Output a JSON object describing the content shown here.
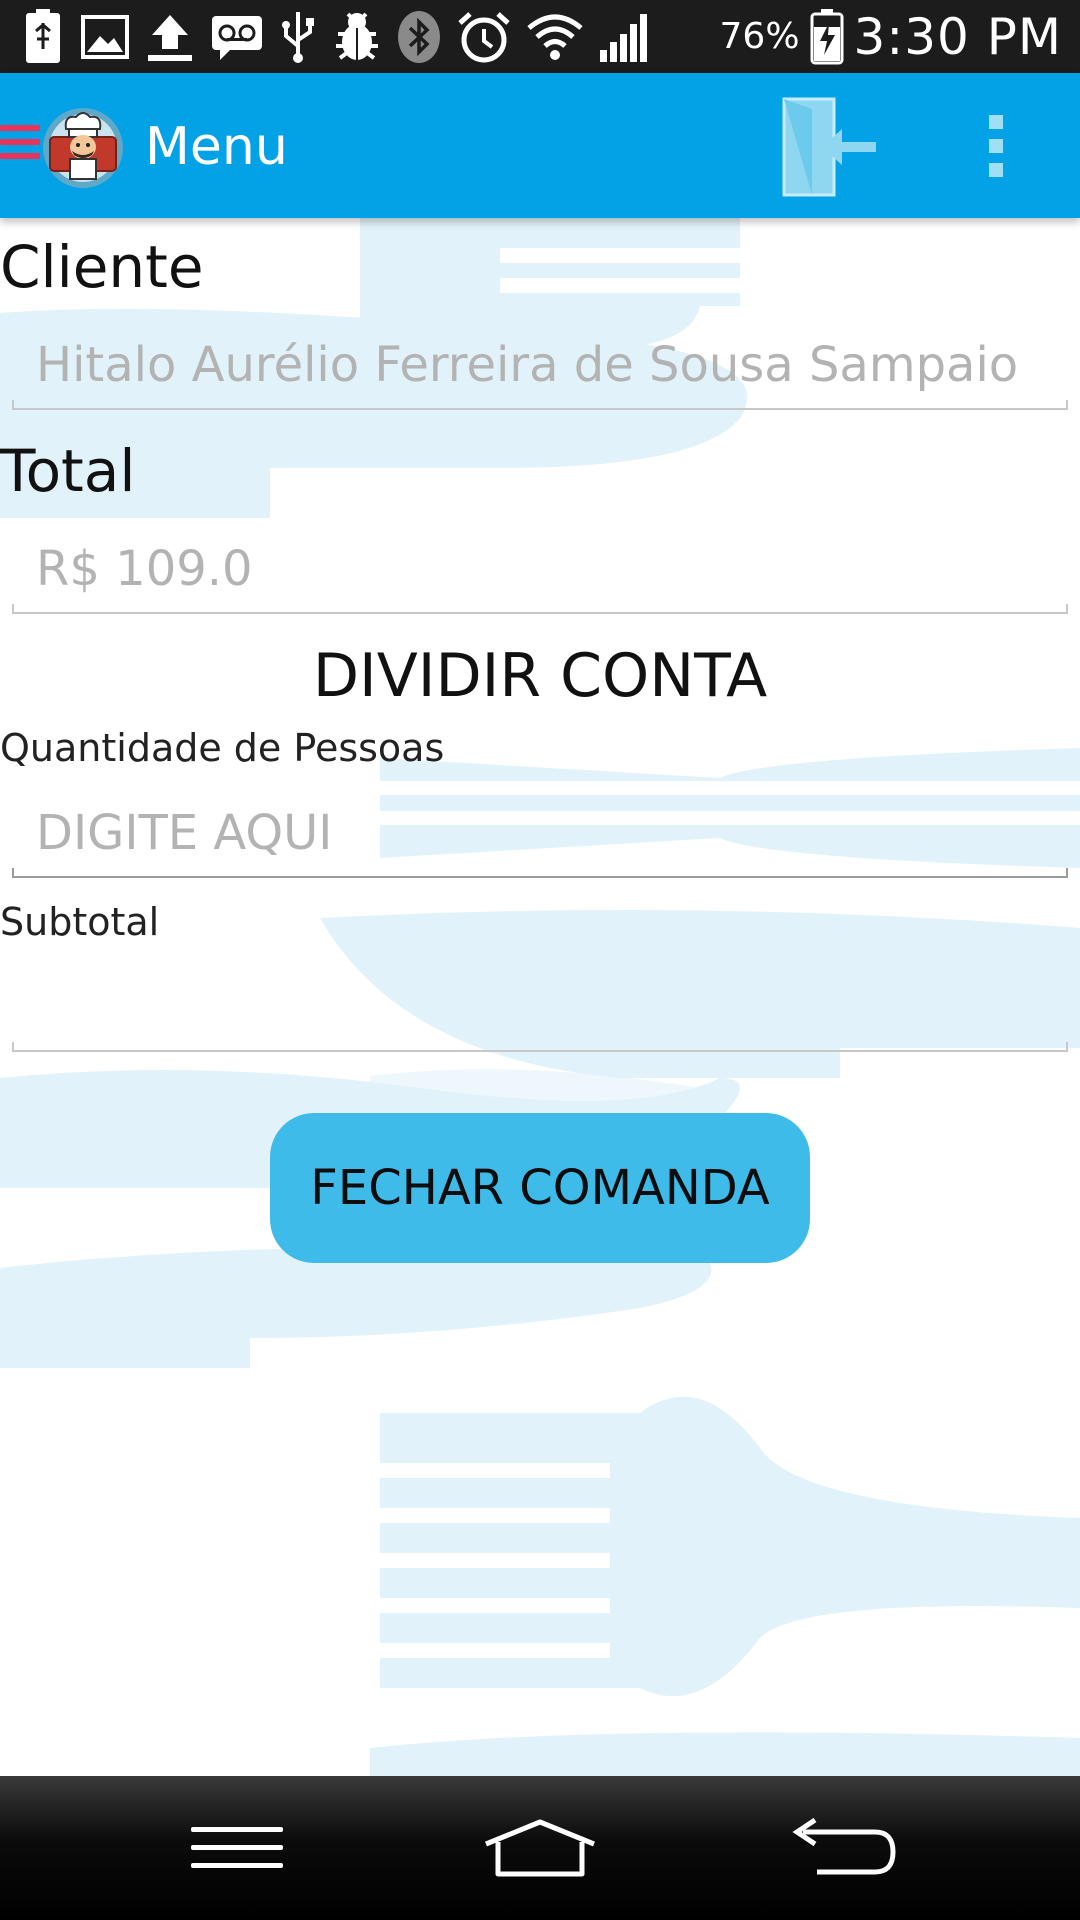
{
  "status_bar": {
    "battery_percent": "76%",
    "time": "3:30 PM",
    "icons": [
      "usb-battery-icon",
      "image-icon",
      "upload-icon",
      "voicemail-icon",
      "usb-icon",
      "debug-icon",
      "bluetooth-icon",
      "alarm-icon",
      "wifi-icon",
      "signal-icon",
      "battery-charging-icon"
    ]
  },
  "action_bar": {
    "title": "Menu",
    "accent_color": "#03a1e6",
    "icons": [
      "drawer-menu-icon",
      "chef-logo-icon",
      "logout-icon",
      "overflow-menu-icon"
    ]
  },
  "form": {
    "cliente_label": "Cliente",
    "cliente_value": "Hitalo Aurélio Ferreira de Sousa Sampaio",
    "total_label": "Total",
    "total_value": "R$ 109.0",
    "dividir_title": "DIVIDIR CONTA",
    "pessoas_label": "Quantidade de Pessoas",
    "pessoas_placeholder": "DIGITE AQUI",
    "subtotal_label": "Subtotal",
    "subtotal_value": "",
    "fechar_button": "FECHAR COMANDA",
    "button_color": "#3fbbea"
  },
  "nav_bar": {
    "icons": [
      "recent-apps-icon",
      "home-icon",
      "back-icon"
    ]
  }
}
